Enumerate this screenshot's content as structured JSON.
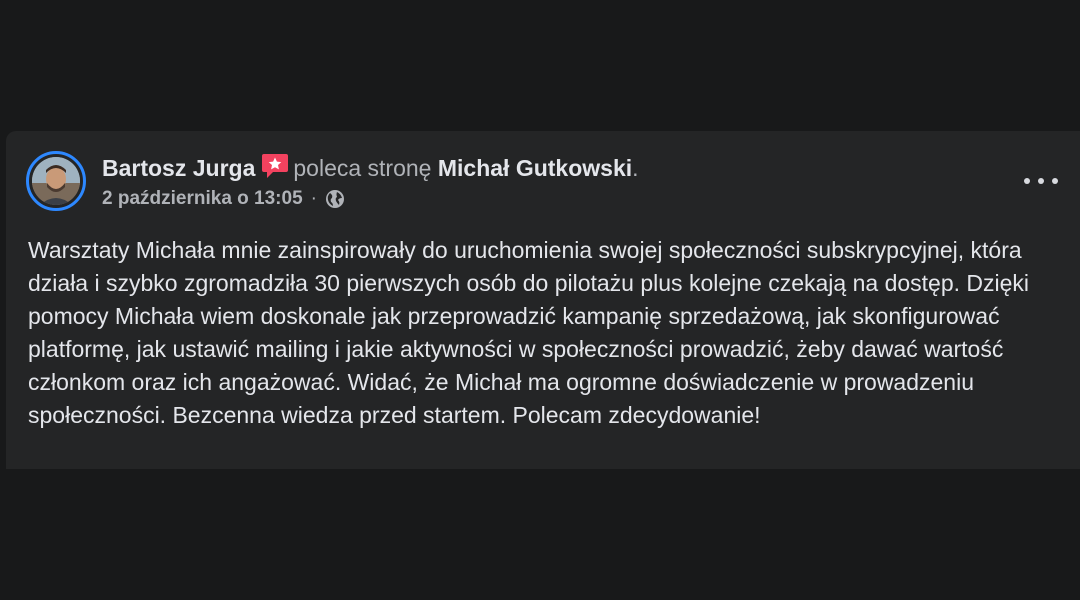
{
  "post": {
    "author": "Bartosz Jurga",
    "action": "poleca stronę",
    "page_name": "Michał Gutkowski",
    "period": ".",
    "date": "2 października o 13:05",
    "separator": "·",
    "audience_icon": "globe-icon",
    "recommend_icon": "recommend-star-icon",
    "more_icon": "more-options-icon",
    "text": "Warsztaty Michała mnie zainspirowały do uruchomienia swojej społeczności subskrypcyjnej, która działa i szybko zgromadziła 30 pierwszych osób do pilotażu plus kolejne czekają na dostęp. Dzięki pomocy Michała wiem doskonale jak przeprowadzić kampanię sprzedażową, jak skonfigurować platformę, jak ustawić mailing i jakie aktywności w społeczności prowadzić, żeby dawać wartość członkom oraz ich angażować. Widać, że Michał ma ogromne doświadczenie w prowadzeniu społeczności. Bezcenna wiedza przed startem. Polecam zdecydowanie!"
  },
  "colors": {
    "page_bg": "#18191a",
    "card_bg": "#242526",
    "primary_text": "#e4e6eb",
    "secondary_text": "#b0b3b8",
    "avatar_ring": "#2d88ff",
    "recommend_badge": "#f3425f"
  }
}
